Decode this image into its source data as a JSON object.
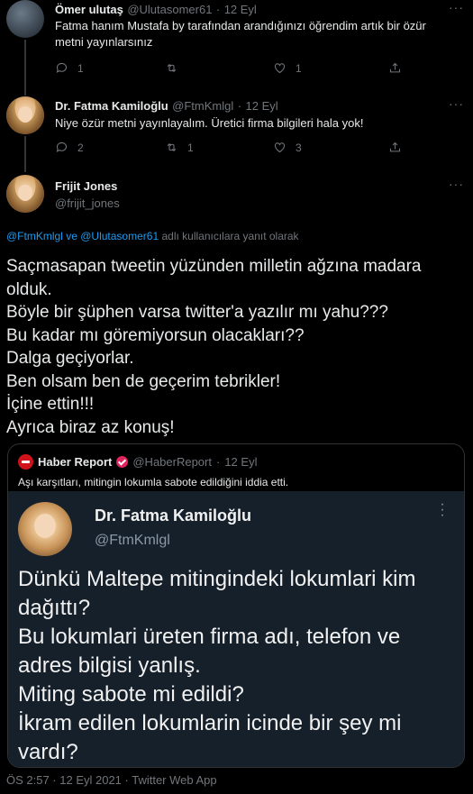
{
  "tweet1": {
    "name": "Ömer ulutaş",
    "handle": "@Ulutasomer61",
    "sep": "·",
    "date": "12 Eyl",
    "text_line1": "Fatma hanım Mustafa by  tarafından arandığınızı öğrendim artık bir özür",
    "text_line2": "metni yayınlarsınız",
    "replies": "1",
    "retweets": "",
    "likes": "1"
  },
  "tweet2": {
    "name": "Dr. Fatma Kamiloğlu",
    "handle": "@FtmKmlgl",
    "sep": "·",
    "date": "12 Eyl",
    "text": "Niye özür metni yayınlayalım. Üretici firma bilgileri hala yok!",
    "replies": "2",
    "retweets": "1",
    "likes": "3"
  },
  "main_tweet": {
    "name": "Frijit Jones",
    "handle": "@frijit_jones",
    "reply_to_1": "@FtmKmlgl",
    "reply_to_and": "ve",
    "reply_to_2": "@Ulutasomer61",
    "reply_to_suffix": "adlı kullanıcılara yanıt olarak",
    "lines": [
      "Saçmasapan tweetin yüzünden milletin ağzına madara",
      "olduk.",
      "Böyle bir şüphen varsa twitter'a yazılır mı yahu???",
      "Bu kadar mı göremiyorsun olacakları??",
      "Dalga geçiyorlar.",
      "Ben olsam ben de geçerim tebrikler!",
      "İçine ettin!!!",
      "Ayrıca biraz az konuş!"
    ],
    "footer": "ÖS 2:57 · 12 Eyl 2021 · Twitter Web App"
  },
  "quote": {
    "name": "Haber Report",
    "handle": "@HaberReport",
    "sep": "·",
    "date": "12 Eyl",
    "text": "Aşı karşıtları, mitingin lokumla sabote edildiğini iddia etti.",
    "image": {
      "name": "Dr. Fatma Kamiloğlu",
      "handle": "@FtmKmlgl",
      "lines": [
        "Dünkü Maltepe mitingindeki lokumlari kim",
        "dağıttı?",
        "Bu lokumlari üreten firma adı, telefon ve",
        "adres bilgisi yanlış.",
        "Miting sabote mi edildi?",
        "İkram edilen lokumlarin icinde bir şey mi",
        "vardı?"
      ]
    }
  },
  "colors": {
    "background": "#000000",
    "text": "#e7e9ea",
    "muted": "#71767b",
    "link": "#1d9bf0",
    "border": "#2f3336",
    "haber_red": "#d0121b"
  },
  "icons": [
    "reply-icon",
    "retweet-icon",
    "like-icon",
    "share-icon",
    "more-icon",
    "verified-icon"
  ]
}
